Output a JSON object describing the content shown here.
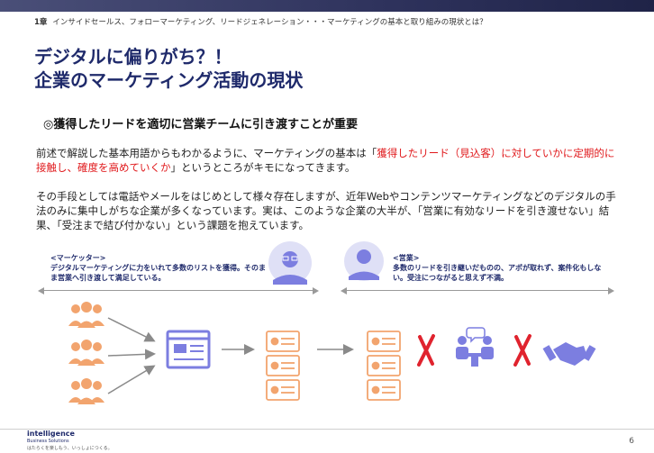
{
  "header": {
    "chapter_num": "1章",
    "chapter_text": "インサイドセールス、フォローマーケティング、リードジェネレーション・・・マーケティングの基本と取り組みの現状とは？"
  },
  "title": {
    "line1": "デジタルに偏りがち？！",
    "line2": "企業のマーケティング活動の現状"
  },
  "subheading": "◎獲得したリードを適切に営業チームに引き渡すことが重要",
  "paragraph1": {
    "before": "前述で解説した基本用語からもわかるように、マーケティングの基本は「",
    "highlight": "獲得したリード（見込客）に対していかに定期的に接触し、確度を高めていくか",
    "after": "」というところがキモになってきます。"
  },
  "paragraph2": "その手段としては電話やメールをはじめとして様々存在しますが、近年Webやコンテンツマーケティングなどのデジタルの手法のみに集中しがちな企業が多くなっています。実は、このような企業の大半が、「営業に有効なリードを引き渡せない」結果、「受注まで結び付かない」という課題を抱えています。",
  "marketer": {
    "heading": "<マーケッター>",
    "text": "デジタルマーケティングに力をいれて多数のリストを獲得。そのまま営業へ引き渡して満足している。"
  },
  "sales": {
    "heading": "<営業>",
    "text": "多数のリードを引き継いだものの、アポが取れず、案件化もしない。受注につながると思えず不満。"
  },
  "footer": {
    "logo_name": "intelligence",
    "logo_sub": "Business Solutions",
    "logo_tagline": "はたらくを楽しもう、いっしょにつくる。",
    "page_number": "6"
  },
  "colors": {
    "accent_orange": "#f2a46e",
    "accent_navy": "#1f2a6b",
    "person_purple": "#7c7ee0",
    "cross_red": "#e0232e"
  }
}
